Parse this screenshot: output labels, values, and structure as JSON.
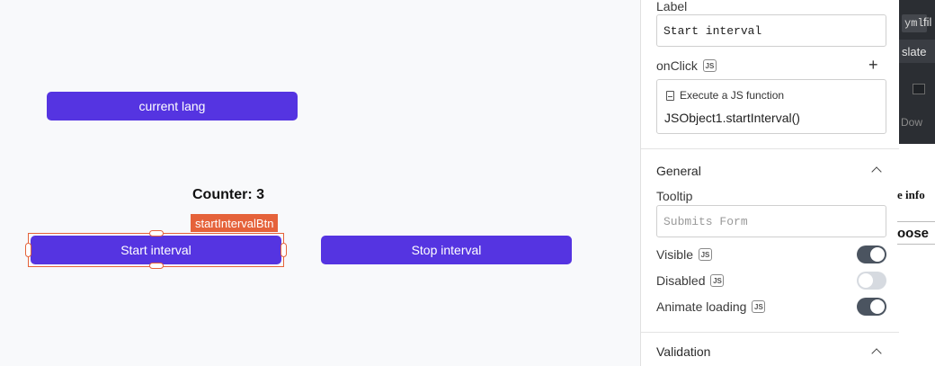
{
  "canvas": {
    "buttons": {
      "current_lang": "current lang",
      "start_interval": "Start interval",
      "stop_interval": "Stop interval"
    },
    "counter_text": "Counter: 3",
    "selected_widget_tag": "startIntervalBtn"
  },
  "property_pane": {
    "label_field": {
      "label": "Label",
      "value": "Start interval"
    },
    "onclick": {
      "label": "onClick",
      "js_badge": "JS",
      "add_icon": "plus-icon",
      "action_title": "Execute a JS function",
      "action_code": "JSObject1.startInterval()"
    },
    "general": {
      "title": "General",
      "tooltip_label": "Tooltip",
      "tooltip_placeholder": "Submits Form",
      "visible_label": "Visible",
      "visible_on": true,
      "disabled_label": "Disabled",
      "disabled_on": false,
      "animate_loading_label": "Animate loading",
      "animate_loading_on": true
    },
    "validation": {
      "title": "Validation"
    }
  },
  "right_window": {
    "code_tag": "yml",
    "file_text": "fil",
    "slate_text": "slate",
    "download_text": "Dow",
    "info_text": "e info",
    "choose_text": "oose"
  },
  "colors": {
    "button_primary": "#5534e1",
    "selection": "#e5623a",
    "toggle_on": "#4b5460",
    "toggle_off": "#d6dae0"
  }
}
